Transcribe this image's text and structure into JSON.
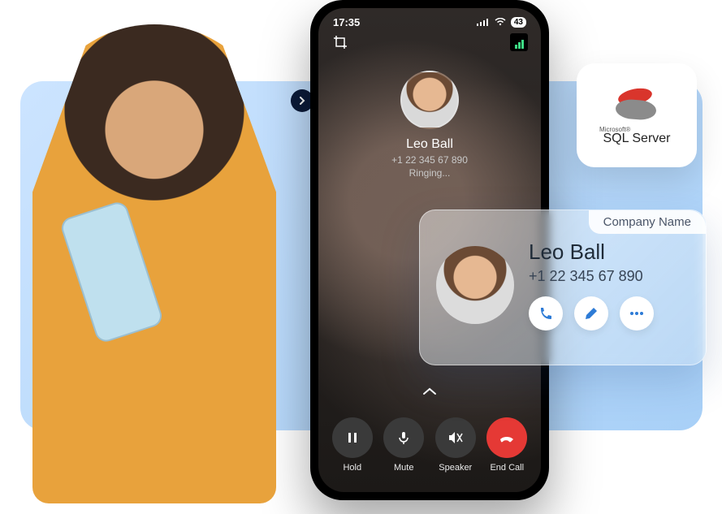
{
  "phone": {
    "status": {
      "time": "17:35",
      "battery": "43"
    },
    "caller": {
      "name": "Leo Ball",
      "phone": "+1 22 345 67 890",
      "status": "Ringing..."
    },
    "actions": {
      "hold": "Hold",
      "mute": "Mute",
      "speaker": "Speaker",
      "end": "End Call"
    }
  },
  "sql_card": {
    "brand_small": "Microsoft®",
    "brand": "SQL Server"
  },
  "contact_card": {
    "company_label": "Company Name",
    "name": "Leo Ball",
    "phone": "+1 22 345 67 890"
  }
}
